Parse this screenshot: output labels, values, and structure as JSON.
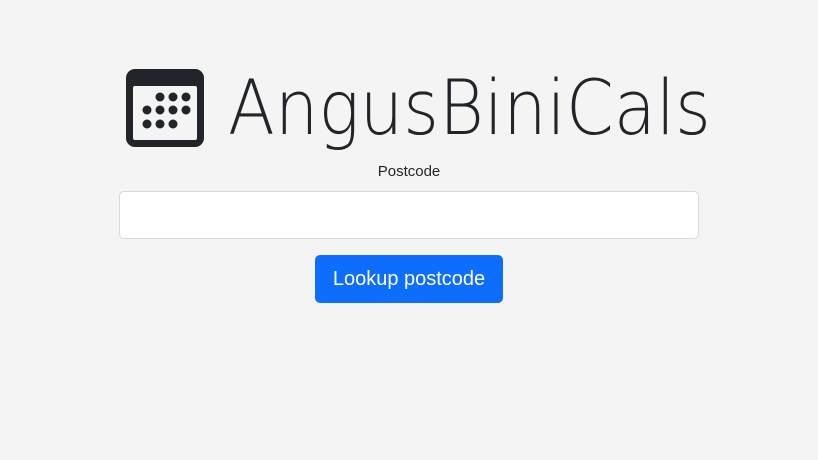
{
  "app": {
    "title": "AngusBiniCals",
    "icon": "calendar-icon"
  },
  "form": {
    "postcode_label": "Postcode",
    "postcode_value": "",
    "postcode_placeholder": "",
    "lookup_button_label": "Lookup postcode"
  },
  "colors": {
    "background": "#f4f4f4",
    "text": "#212529",
    "primary_button": "#0d6efd",
    "input_border": "#d7d9dc"
  }
}
